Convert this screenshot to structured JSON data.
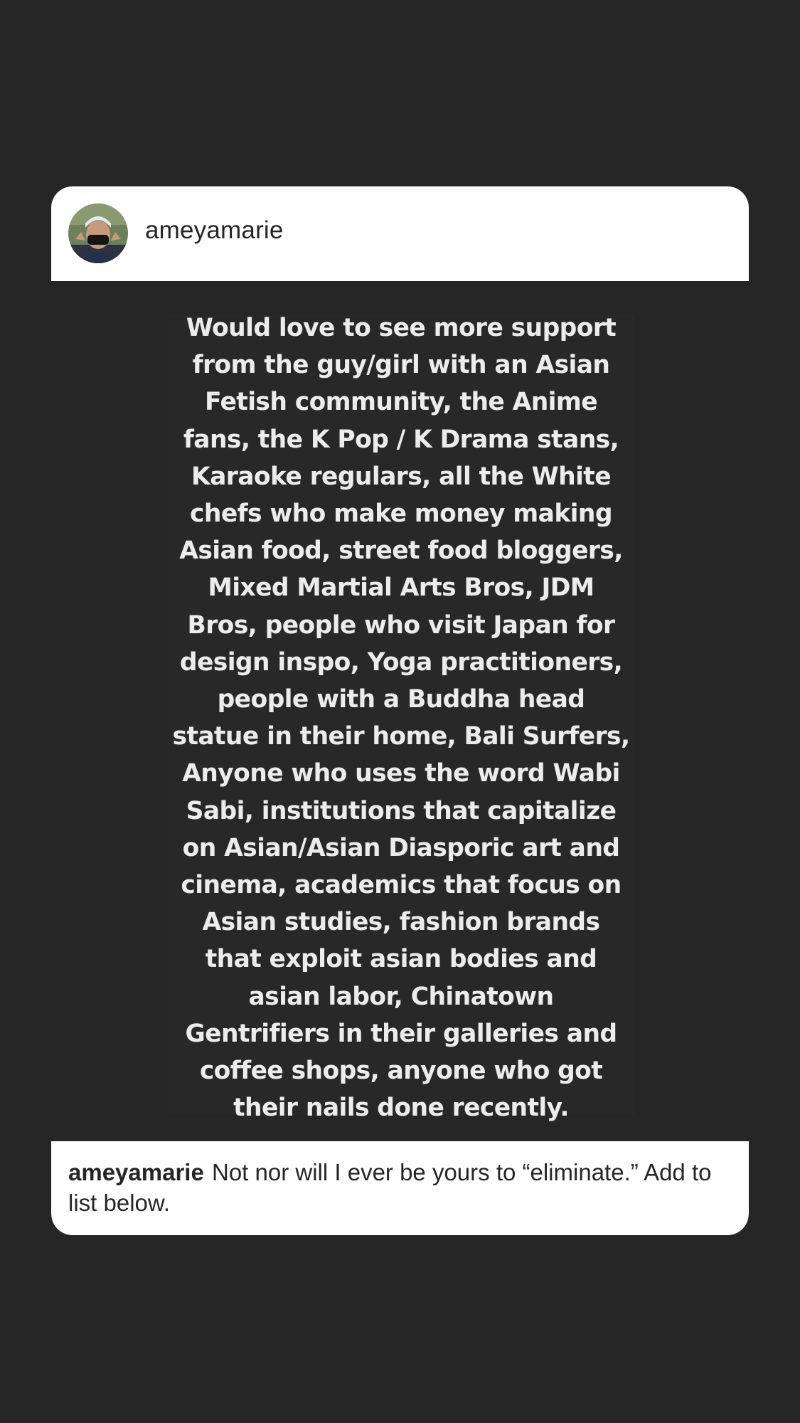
{
  "post": {
    "username": "ameyamarie",
    "avatar_icon": "profile-photo-avatar",
    "quote_lines": [
      "Would love to see more support",
      "from the guy/girl with an Asian",
      "Fetish community, the Anime",
      "fans, the K Pop / K Drama stans,",
      "Karaoke regulars, all the White",
      "chefs who make money making",
      "Asian food, street food bloggers,",
      "Mixed Martial Arts Bros, JDM",
      "Bros, people who visit Japan for",
      "design inspo, Yoga practitioners,",
      "people with a Buddha head",
      "statue in their home, Bali Surfers,",
      "Anyone who uses the word Wabi",
      "Sabi, institutions that capitalize",
      "on Asian/Asian Diasporic art and",
      "cinema, academics that focus on",
      "Asian studies, fashion brands",
      "that exploit asian bodies and",
      "asian labor, Chinatown",
      "Gentrifiers in their galleries and",
      "coffee shops, anyone who got",
      "their nails done recently."
    ],
    "caption": {
      "username": "ameyamarie",
      "text": "Not nor will I ever be yours to “eliminate.” Add to list below."
    }
  },
  "colors": {
    "background": "#262626",
    "card_header": "#ffffff",
    "quote_text": "#ececec"
  }
}
